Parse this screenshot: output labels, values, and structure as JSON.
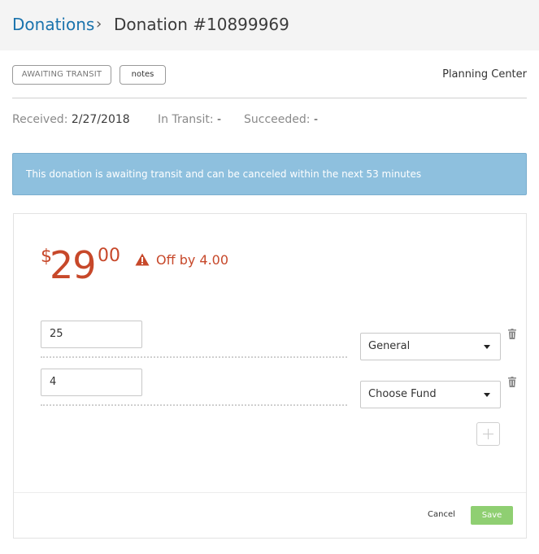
{
  "breadcrumb": {
    "parent": "Donations",
    "separator": "›",
    "current": "Donation #10899969"
  },
  "header": {
    "status_badge": "AWAITING TRANSIT",
    "notes_button": "notes",
    "organization": "Planning Center"
  },
  "dates": {
    "received_label": "Received:",
    "received_value": "2/27/2018",
    "in_transit_label": "In Transit:",
    "in_transit_value": "-",
    "succeeded_label": "Succeeded:",
    "succeeded_value": "-"
  },
  "alert": {
    "message": "This donation is awaiting transit and can be canceled within the next 53 minutes"
  },
  "donation": {
    "currency_symbol": "$",
    "amount_whole": "29",
    "amount_cents": "00",
    "warning_text": "Off by 4.00",
    "designations": [
      {
        "amount": "25",
        "fund": "General"
      },
      {
        "amount": "4",
        "fund": "Choose Fund"
      }
    ]
  },
  "actions": {
    "cancel_label": "Cancel",
    "save_label": "Save"
  },
  "colors": {
    "link": "#1a73ad",
    "alert_bg": "#8ec0de",
    "error": "#c7482a",
    "save_bg": "#8fcf72"
  }
}
